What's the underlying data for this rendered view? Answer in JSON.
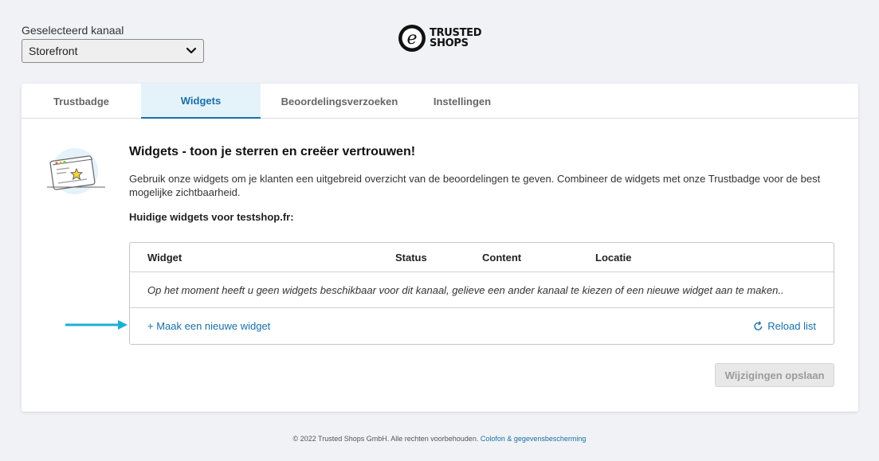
{
  "channel": {
    "label": "Geselecteerd kanaal",
    "selected": "Storefront"
  },
  "logo": {
    "line1": "TRUSTED",
    "line2": "SHOPS"
  },
  "tabs": [
    {
      "label": "Trustbadge",
      "active": false
    },
    {
      "label": "Widgets",
      "active": true
    },
    {
      "label": "Beoordelingsverzoeken",
      "active": false
    },
    {
      "label": "Instellingen",
      "active": false
    }
  ],
  "main": {
    "heading": "Widgets - toon je sterren en creëer vertrouwen!",
    "description": "Gebruik onze widgets om je klanten een uitgebreid overzicht van de beoordelingen te geven. Combineer de widgets met onze Trustbadge voor de best mogelijke zichtbaarheid.",
    "current_widgets": "Huidige widgets voor testshop.fr:"
  },
  "table": {
    "columns": [
      "Widget",
      "Status",
      "Content",
      "Locatie"
    ],
    "empty_message": "Op het moment heeft u geen widgets beschikbaar voor dit kanaal, gelieve een ander kanaal te kiezen of een nieuwe widget aan te maken..",
    "create_link": "+ Maak een nieuwe widget",
    "reload_link": "Reload list"
  },
  "save_button": "Wijzigingen opslaan",
  "footer": {
    "copyright": "© 2022 Trusted Shops GmbH. Alle rechten voorbehouden.",
    "link": "Colofon & gegevensbescherming"
  },
  "colors": {
    "accent": "#1a6fa8",
    "active_tab_bg": "#e4f3fa",
    "arrow": "#1ab0d6",
    "background": "#f0f2f5"
  }
}
